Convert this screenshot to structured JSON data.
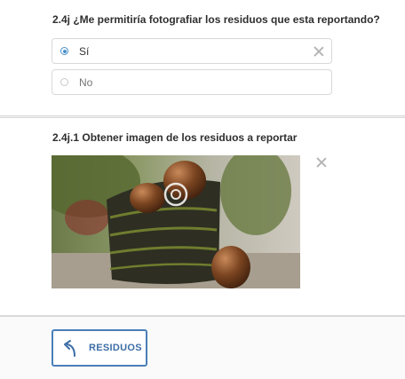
{
  "question_1": {
    "title": "2.4j ¿Me permitiría fotografiar los residuos que esta reportando?",
    "options": [
      {
        "label": "Sí",
        "selected": true
      },
      {
        "label": "No",
        "selected": false
      }
    ],
    "clear_icon": "close-icon"
  },
  "question_2": {
    "title": "2.4j.1 Obtener imagen de los residuos a reportar",
    "image": "avocado-photo",
    "remove_icon": "close-icon"
  },
  "navigation": {
    "back_label": "RESIDUOS",
    "back_icon": "curved-arrow-back-icon"
  },
  "colors": {
    "accent": "#4a7fb8",
    "radio_selected": "#4a90c8",
    "border": "#d8d8d8",
    "page_bg": "#f3f3f3"
  }
}
